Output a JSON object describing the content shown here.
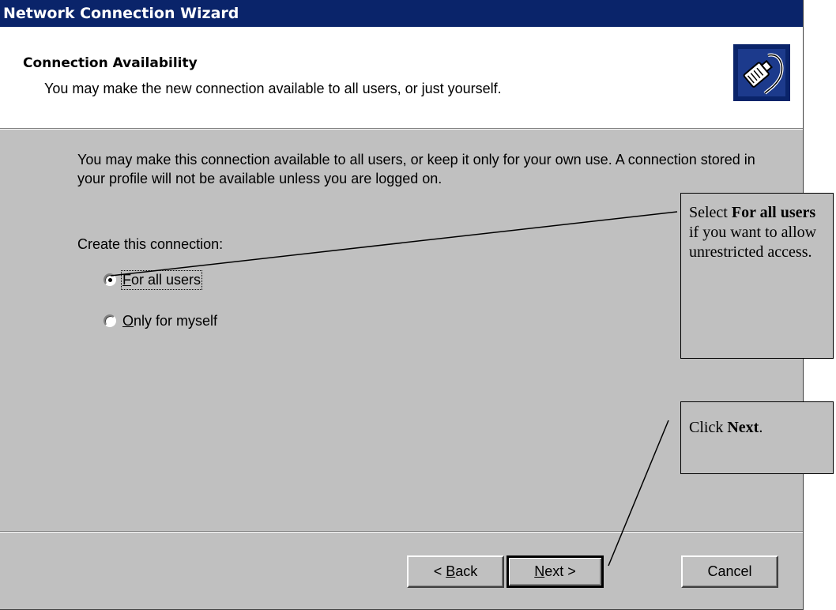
{
  "window": {
    "title": "Network Connection Wizard"
  },
  "header": {
    "title": "Connection Availability",
    "subtitle": "You may make the new connection available to all users, or just yourself.",
    "icon": "network-plug-icon"
  },
  "body": {
    "intro": "You may make this connection available to all users, or keep it only for your own use.  A connection stored in your profile will not be available unless you are logged on.",
    "group_label": "Create this connection:",
    "options": [
      {
        "accel": "F",
        "rest": "or all users",
        "selected": true
      },
      {
        "accel": "O",
        "rest": "nly for myself",
        "selected": false
      }
    ]
  },
  "buttons": {
    "back": {
      "prefix": "< ",
      "accel": "B",
      "rest": "ack"
    },
    "next": {
      "accel": "N",
      "rest": "ext >"
    },
    "cancel": "Cancel"
  },
  "callouts": {
    "select": {
      "pre": "Select ",
      "bold": "For all users",
      "post": " if you want to allow unrestricted access."
    },
    "next": {
      "pre": "Click ",
      "bold": "Next",
      "post": "."
    }
  },
  "colors": {
    "titlebar": "#0a246a",
    "face": "#c0c0c0",
    "header_bg": "#ffffff"
  }
}
